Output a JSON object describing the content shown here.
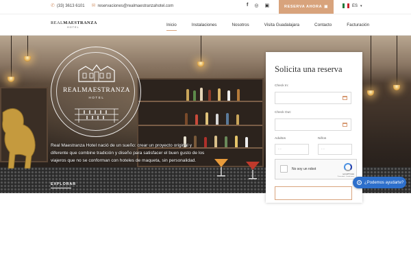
{
  "topbar": {
    "phone_icon": "phone-icon",
    "phone": "(33) 3613 6101",
    "email_icon": "envelope-icon",
    "email": "reservaciones@realmaestranzahotel.com",
    "social_icons": [
      "facebook-icon",
      "whatsapp-icon",
      "instagram-icon"
    ],
    "reserve_label": "RESERVA AHORA",
    "lang": "ES"
  },
  "navbar": {
    "logo_brand_left": "REAL",
    "logo_brand_right": "MAESTRANZA",
    "logo_sub": "HOTEL",
    "items": [
      "Inicio",
      "Instalaciones",
      "Nosotros",
      "Visita Guadalajara",
      "Contacto",
      "Facturación"
    ],
    "active_index": 0
  },
  "hero": {
    "emblem_title": "REALMAESTRANZA",
    "emblem_sub": "HOTEL",
    "text": "Real Maestranza Hotel nació de un sueño: crear un proyecto original y diferente que combine tradición y diseño para satisfacer el buen gusto de los viajeros que no se conforman con hoteles de maqueta, sin personalidad.",
    "explore_label": "EXPLORAR"
  },
  "booking_form": {
    "title": "Solicita una reserva",
    "checkin_label": "Check In:",
    "checkout_label": "Check Out:",
    "adults_label": "Adultos",
    "adults_placeholder": "- -",
    "kids_label": "Niños",
    "kids_placeholder": "- -",
    "captcha_label": "No soy un robot",
    "captcha_brand": "reCAPTCHA",
    "captcha_terms": "Privacidad - Condiciones"
  },
  "whatsapp_chat": {
    "label": "¿Podemos ayudarte?"
  },
  "colors": {
    "accent": "#d8a37c",
    "chat_blue": "#2d6fcb"
  }
}
